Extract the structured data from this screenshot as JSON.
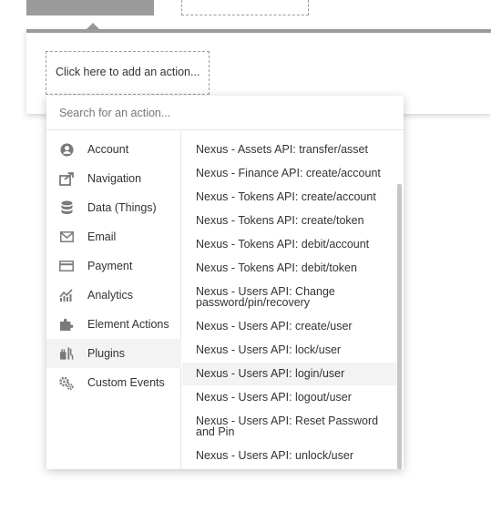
{
  "add_action_placeholder": "Click here to add an action...",
  "search": {
    "placeholder": "Search for an action..."
  },
  "categories": [
    {
      "label": "Account",
      "icon": "user-circle-icon"
    },
    {
      "label": "Navigation",
      "icon": "external-link-icon"
    },
    {
      "label": "Data (Things)",
      "icon": "database-icon"
    },
    {
      "label": "Email",
      "icon": "envelope-icon"
    },
    {
      "label": "Payment",
      "icon": "credit-card-icon"
    },
    {
      "label": "Analytics",
      "icon": "chart-icon"
    },
    {
      "label": "Element Actions",
      "icon": "puzzle-icon"
    },
    {
      "label": "Plugins",
      "icon": "plug-icon",
      "selected": true
    },
    {
      "label": "Custom Events",
      "icon": "gears-icon"
    }
  ],
  "actions": [
    {
      "label": "Nexus - Assets API: transfer/asset"
    },
    {
      "label": "Nexus - Finance API: create/account"
    },
    {
      "label": "Nexus - Tokens API: create/account"
    },
    {
      "label": "Nexus - Tokens API: create/token"
    },
    {
      "label": "Nexus - Tokens API: debit/account"
    },
    {
      "label": "Nexus - Tokens API: debit/token"
    },
    {
      "label": "Nexus - Users API: Change password/pin/recovery"
    },
    {
      "label": "Nexus - Users API: create/user"
    },
    {
      "label": "Nexus - Users API: lock/user"
    },
    {
      "label": "Nexus - Users API: login/user",
      "hovered": true
    },
    {
      "label": "Nexus - Users API: logout/user"
    },
    {
      "label": "Nexus - Users API: Reset Password and Pin"
    },
    {
      "label": "Nexus - Users API: unlock/user"
    }
  ],
  "colors": {
    "text": "#333333",
    "icon": "#7a7a7a",
    "selected_bg": "#f3f3f3",
    "border": "#9b9b9b"
  }
}
